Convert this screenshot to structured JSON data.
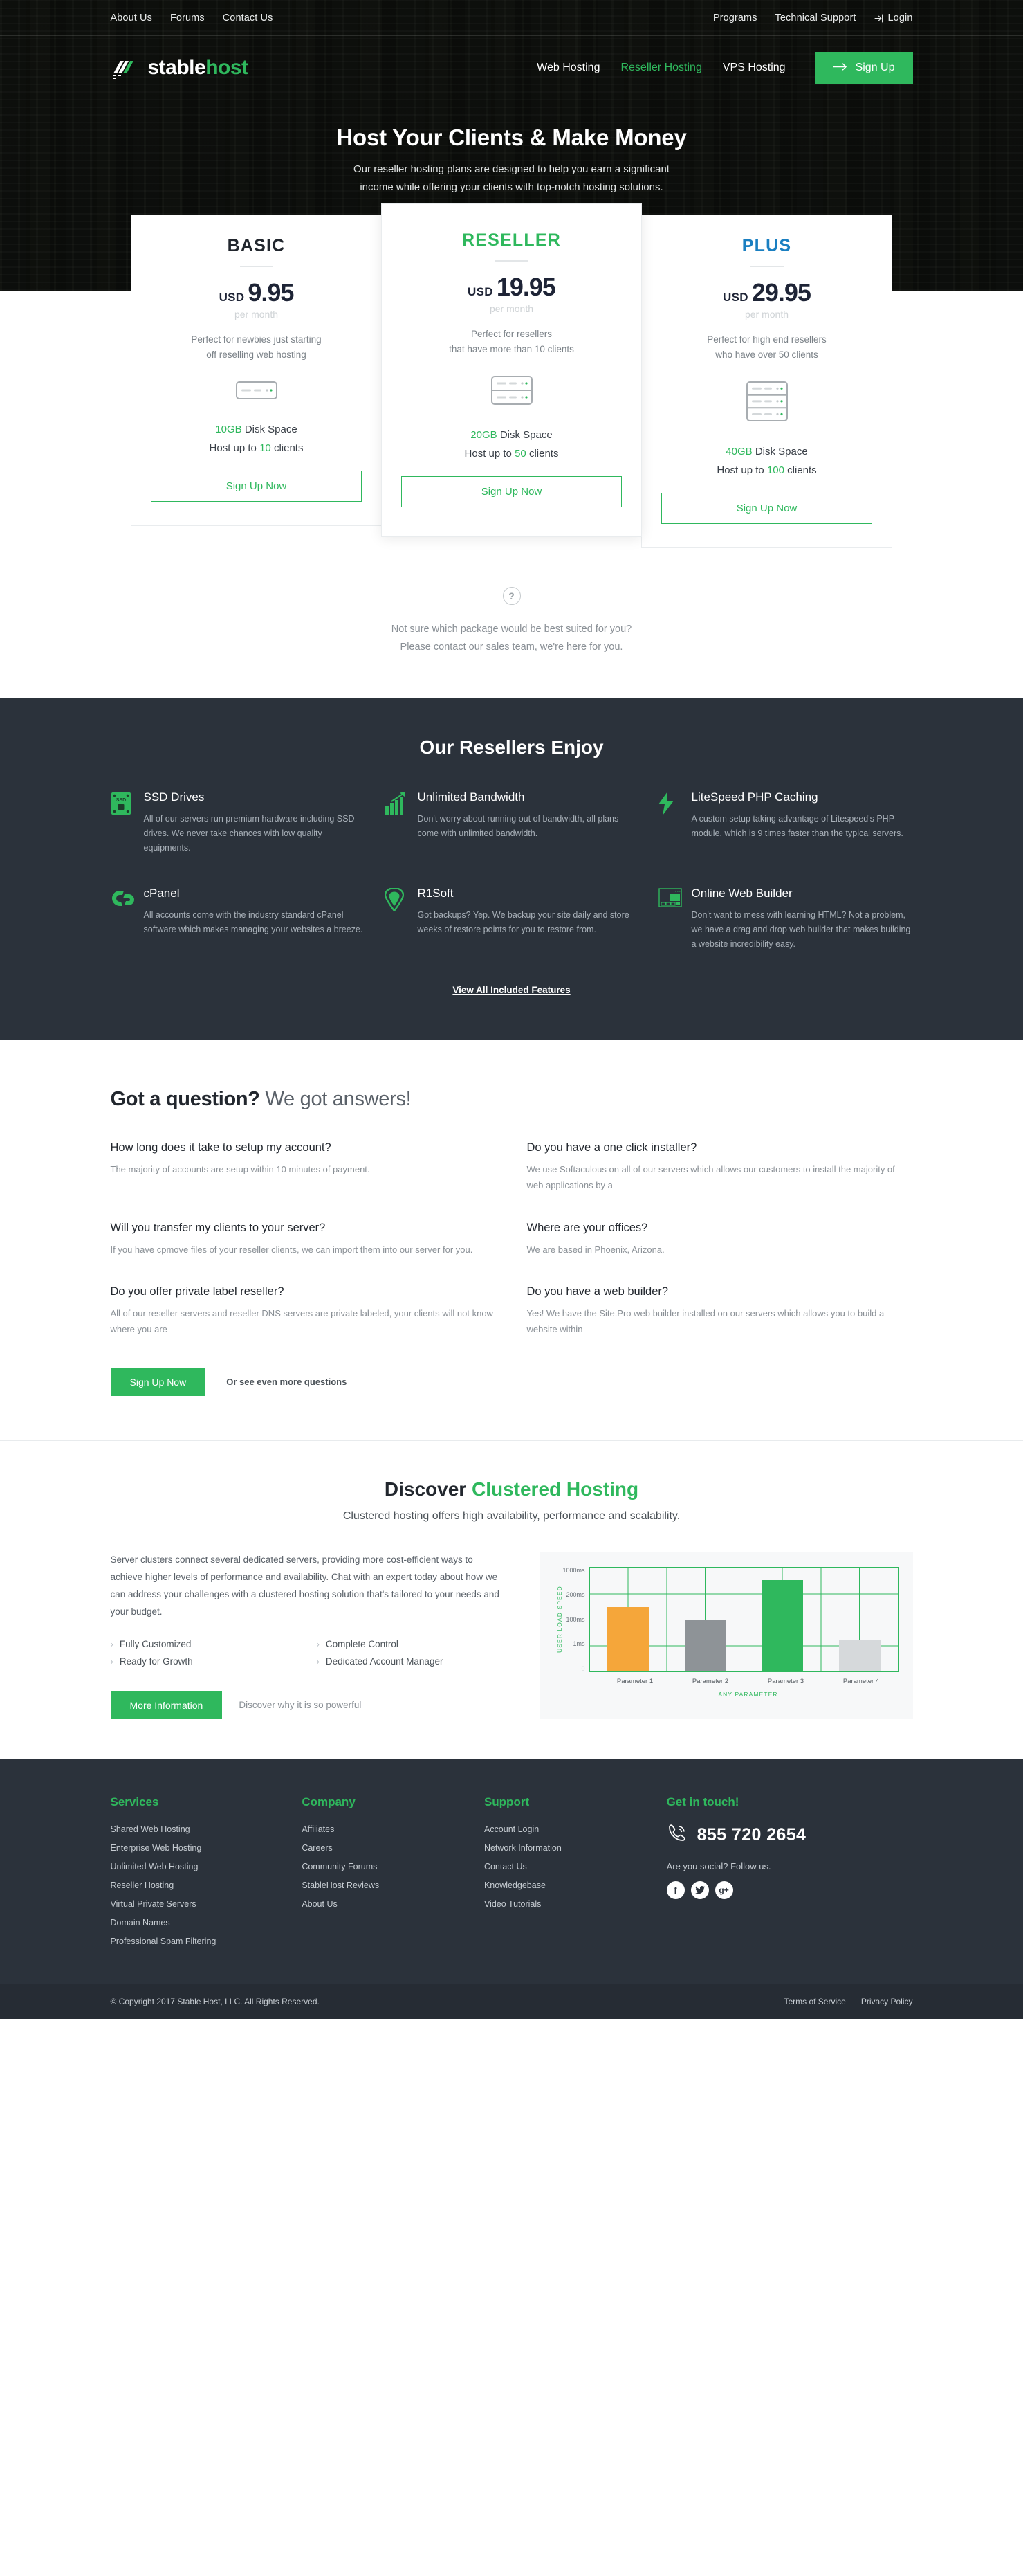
{
  "brand": {
    "name_part1": "stable",
    "name_part2": "host",
    "accent": "#2fb85d",
    "dark": "#2b323b"
  },
  "topbar": {
    "left_links": [
      {
        "label": "About Us"
      },
      {
        "label": "Forums"
      },
      {
        "label": "Contact Us"
      }
    ],
    "right_links": [
      {
        "label": "Programs"
      },
      {
        "label": "Technical Support"
      }
    ],
    "login_label": "Login",
    "login_icon": "login-arrow-icon"
  },
  "nav": {
    "items": [
      {
        "label": "Web Hosting",
        "active": false
      },
      {
        "label": "Reseller Hosting",
        "active": true
      },
      {
        "label": "VPS Hosting",
        "active": false
      }
    ],
    "signup_label": "Sign Up",
    "signup_icon": "arrow-right-icon"
  },
  "hero": {
    "title": "Host Your Clients & Make Money",
    "subtitle_line1": "Our reseller hosting plans are designed to help you earn a significant",
    "subtitle_line2": "income while offering your clients with top-notch hosting solutions."
  },
  "pricing": {
    "plans": [
      {
        "name": "BASIC",
        "name_color": "#22272e",
        "currency": "USD",
        "price": "9.95",
        "period": "per month",
        "desc_line1": "Perfect for newbies just starting",
        "desc_line2": "off reselling web hosting",
        "server_units": 1,
        "disk_value": "10GB",
        "disk_label": "Disk Space",
        "clients_prefix": "Host up to",
        "clients_value": "10",
        "clients_suffix": "clients",
        "cta": "Sign Up Now",
        "featured": false
      },
      {
        "name": "RESELLER",
        "name_color": "#2fb85d",
        "currency": "USD",
        "price": "19.95",
        "period": "per month",
        "desc_line1": "Perfect for resellers",
        "desc_line2": "that have more than 10 clients",
        "server_units": 2,
        "disk_value": "20GB",
        "disk_label": "Disk Space",
        "clients_prefix": "Host up to",
        "clients_value": "50",
        "clients_suffix": "clients",
        "cta": "Sign Up Now",
        "featured": true
      },
      {
        "name": "PLUS",
        "name_color": "#1a7fc1",
        "currency": "USD",
        "price": "29.95",
        "period": "per month",
        "desc_line1": "Perfect for high end resellers",
        "desc_line2": "who have over 50 clients",
        "server_units": 3,
        "disk_value": "40GB",
        "disk_label": "Disk Space",
        "clients_prefix": "Host up to",
        "clients_value": "100",
        "clients_suffix": "clients",
        "cta": "Sign Up Now",
        "featured": false
      }
    ]
  },
  "help": {
    "icon": "question-mark-icon",
    "glyph": "?",
    "line1": "Not sure which package would be best suited for you?",
    "line2": "Please contact our sales team, we're here for you."
  },
  "features": {
    "title": "Our Resellers Enjoy",
    "items": [
      {
        "icon": "ssd-chip-icon",
        "title": "SSD Drives",
        "desc": "All of our servers run premium hardware including SSD drives. We never take chances with low quality equipments."
      },
      {
        "icon": "bar-chart-growth-icon",
        "title": "Unlimited Bandwidth",
        "desc": "Don't worry about running out of bandwidth, all plans come with unlimited bandwidth."
      },
      {
        "icon": "lightning-bolt-icon",
        "title": "LiteSpeed PHP Caching",
        "desc": "A custom setup taking advantage of Litespeed's PHP module, which is 9 times faster than the typical servers."
      },
      {
        "icon": "cpanel-logo-icon",
        "title": "cPanel",
        "desc": "All accounts come with the industry standard cPanel software which makes managing your websites a breeze."
      },
      {
        "icon": "shield-pin-icon",
        "title": "R1Soft",
        "desc": "Got backups? Yep. We backup your site daily and store weeks of restore points for you to restore from."
      },
      {
        "icon": "web-builder-layout-icon",
        "title": "Online Web Builder",
        "desc": "Don't want to mess with learning HTML? Not a problem, we have a drag and drop web builder that makes building a website incredibility easy."
      }
    ],
    "view_all_label": "View All Included Features"
  },
  "faq": {
    "title_bold": "Got a question?",
    "title_light": "We got answers!",
    "items": [
      {
        "q": "How long does it take to setup my account?",
        "a": "The majority of accounts are setup within 10 minutes of payment."
      },
      {
        "q": "Do you have a one click installer?",
        "a": "We use Softaculous on all of our servers which allows our customers to install the majority of web applications by a"
      },
      {
        "q": "Will you transfer my clients to your server?",
        "a": "If you have cpmove files of your reseller clients, we can import them into our server for you."
      },
      {
        "q": "Where are your offices?",
        "a": "We are based in Phoenix, Arizona."
      },
      {
        "q": "Do you offer private label reseller?",
        "a": "All of our reseller servers and reseller DNS servers are private labeled, your clients will not know where you are"
      },
      {
        "q": "Do you have a web builder?",
        "a": "Yes! We have the Site.Pro web builder installed on our servers which allows you to build a website within"
      }
    ],
    "cta_label": "Sign Up Now",
    "more_link_label": "Or see even more questions"
  },
  "clustered": {
    "title_dark": "Discover",
    "title_green": "Clustered Hosting",
    "lede": "Clustered hosting offers high availability, performance and scalability.",
    "body": "Server clusters connect several dedicated servers, providing more cost-efficient ways to achieve higher levels of performance and availability. Chat with an expert today about how we can address your challenges with a clustered hosting solution that's tailored to your needs and your budget.",
    "bullets": [
      {
        "label": "Fully Customized"
      },
      {
        "label": "Complete Control"
      },
      {
        "label": "Ready for Growth"
      },
      {
        "label": "Dedicated Account Manager"
      }
    ],
    "cta_label": "More Information",
    "cta_note": "Discover why it is so powerful"
  },
  "chart_data": {
    "type": "bar",
    "title": "",
    "categories": [
      "Parameter 1",
      "Parameter 2",
      "Parameter 3",
      "Parameter 4"
    ],
    "values": [
      150,
      100,
      600,
      40
    ],
    "bar_colors": [
      "#f5a63a",
      "#8e9397",
      "#2fb85d",
      "#d6d9db"
    ],
    "bar_heights_pct": [
      62,
      50,
      88,
      30
    ],
    "xlabel": "ANY PARAMETER",
    "ylabel": "USER LOAD SPEED",
    "ytick_labels": [
      "1000ms",
      "200ms",
      "100ms",
      "1ms",
      "0"
    ],
    "grid": true,
    "legend": "none",
    "axis_color": "#2fb85d"
  },
  "footer": {
    "columns": [
      {
        "heading": "Services",
        "links": [
          {
            "label": "Shared Web Hosting"
          },
          {
            "label": "Enterprise Web Hosting"
          },
          {
            "label": "Unlimited Web Hosting"
          },
          {
            "label": "Reseller Hosting"
          },
          {
            "label": "Virtual Private Servers"
          },
          {
            "label": "Domain Names"
          },
          {
            "label": "Professional Spam Filtering"
          }
        ]
      },
      {
        "heading": "Company",
        "links": [
          {
            "label": "Affiliates"
          },
          {
            "label": "Careers"
          },
          {
            "label": "Community Forums"
          },
          {
            "label": "StableHost Reviews"
          },
          {
            "label": "About Us"
          }
        ]
      },
      {
        "heading": "Support",
        "links": [
          {
            "label": "Account Login"
          },
          {
            "label": "Network Information"
          },
          {
            "label": "Contact Us"
          },
          {
            "label": "Knowledgebase"
          },
          {
            "label": "Video Tutorials"
          }
        ]
      }
    ],
    "contact": {
      "heading": "Get in touch!",
      "phone_icon": "phone-ringing-icon",
      "phone": "855 720 2654",
      "social_lead": "Are you social? Follow us.",
      "socials": [
        {
          "icon": "facebook-icon",
          "glyph": "f"
        },
        {
          "icon": "twitter-icon",
          "glyph": "t"
        },
        {
          "icon": "google-plus-icon",
          "glyph": "g+"
        }
      ]
    },
    "copyright": "© Copyright 2017 Stable Host, LLC. All Rights Reserved.",
    "legal_links": [
      {
        "label": "Terms of Service"
      },
      {
        "label": "Privacy Policy"
      }
    ]
  }
}
